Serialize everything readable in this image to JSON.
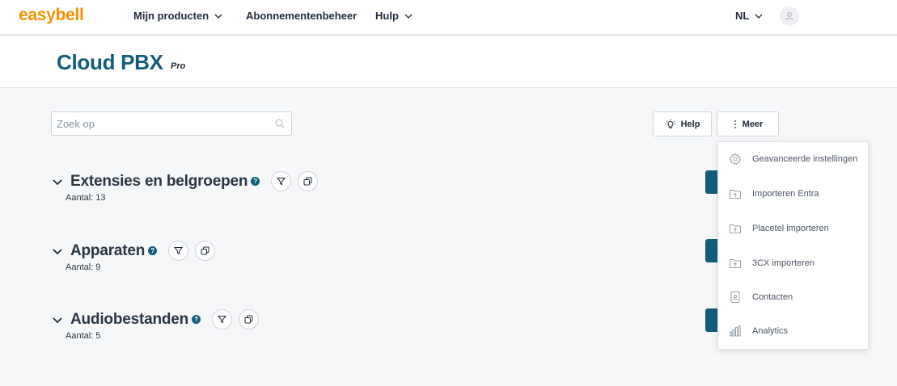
{
  "brand": {
    "logo": "easybell",
    "color": "#f39200"
  },
  "nav": {
    "items": [
      {
        "label": "Mijn producten",
        "has_dropdown": true
      },
      {
        "label": "Abonnementenbeheer",
        "has_dropdown": false
      },
      {
        "label": "Hulp",
        "has_dropdown": true
      }
    ],
    "language": "NL",
    "avatar_icon": "user-icon"
  },
  "header": {
    "title": "Cloud PBX",
    "subtitle": "Pro",
    "title_color": "#135c7b"
  },
  "search": {
    "placeholder": "Zoek op",
    "value": ""
  },
  "toolbar": {
    "help_label": "Help",
    "more_label": "Meer"
  },
  "sections": [
    {
      "title": "Extensies en belgroepen",
      "count": "Aantal: 13"
    },
    {
      "title": "Apparaten",
      "count": "Aantal: 9"
    },
    {
      "title": "Audiobestanden",
      "count": "Aantal: 5"
    }
  ],
  "more_menu": {
    "items": [
      {
        "label": "Geavanceerde instellingen",
        "icon": "gear-icon"
      },
      {
        "label": "Importeren Entra",
        "icon": "folder-import-icon"
      },
      {
        "label": "Placetel importeren",
        "icon": "folder-import-icon"
      },
      {
        "label": "3CX importeren",
        "icon": "folder-import-icon"
      },
      {
        "label": "Contacten",
        "icon": "contacts-icon"
      },
      {
        "label": "Analytics",
        "icon": "bar-chart-icon"
      }
    ]
  }
}
